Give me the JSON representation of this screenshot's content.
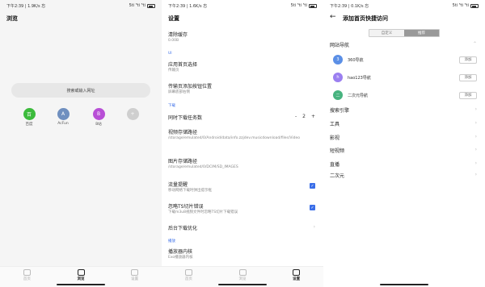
{
  "panel1": {
    "status": {
      "time": "下午2:39 | 1.9K/s 忘",
      "icons": "5ti ⁵ti ⁵ti"
    },
    "title": "浏览",
    "search_placeholder": "搜索或输入网址",
    "shortcuts": [
      {
        "glyph": "百",
        "label": "百度",
        "color": "#3cbb3c"
      },
      {
        "glyph": "A",
        "label": "AcFun",
        "color": "#6f8fbf"
      },
      {
        "glyph": "B",
        "label": "B站",
        "color": "#b84fd6"
      },
      {
        "glyph": "+",
        "label": "",
        "color": "#cfcfcf"
      }
    ],
    "nav": [
      {
        "label": "首页",
        "active": false
      },
      {
        "label": "浏览",
        "active": true
      },
      {
        "label": "设置",
        "active": false
      }
    ]
  },
  "panel2": {
    "status": {
      "time": "下午2:39 | 1.6K/s 忘",
      "icons": "5ti ⁵ti ⁵ti"
    },
    "title": "设置",
    "clear_cache": {
      "title": "清除缓存",
      "sub": "0.00B"
    },
    "ui_header": "UI",
    "app_home": {
      "title": "应用首页选择",
      "sub": "传输页"
    },
    "transfer_btn": {
      "title": "传输页添加按钮位置",
      "sub": "屏幕底部右侧"
    },
    "download_header": "下载",
    "concurrent": {
      "title": "同时下载任务数",
      "minus": "-",
      "value": "2",
      "plus": "+"
    },
    "video_path": {
      "title": "视频存储路径",
      "sub": "/storage/emulated/0/Android/data/info.zzjdev.musicdownload/files/Video"
    },
    "image_path": {
      "title": "图片存储路径",
      "sub": "/storage/emulated/0/DCIM/SD_IMAGES"
    },
    "traffic": {
      "title": "流量提醒",
      "sub": "移动网络下载时弹出提示框",
      "checked": true
    },
    "ignore_ts": {
      "title": "忽略TS切片错误",
      "sub": "下载m3u8视频文件时忽略TS切片下载错误",
      "checked": true
    },
    "bg_opt": {
      "title": "后台下载优化"
    },
    "play_header": "播放",
    "player": {
      "title": "播放器内核",
      "sub": "Exo播放器内核"
    },
    "nav": [
      {
        "label": "首页",
        "active": false
      },
      {
        "label": "浏览",
        "active": false
      },
      {
        "label": "设置",
        "active": true
      }
    ]
  },
  "panel3": {
    "status": {
      "time": "下午2:39 | 0.1K/s 忘",
      "icons": "5ti ⁵ti ⁵ti"
    },
    "back": "←",
    "title": "添加首页快捷访问",
    "tabs": [
      {
        "label": "自定义",
        "active": false
      },
      {
        "label": "推荐",
        "active": true
      }
    ],
    "section_open": "网站导航",
    "sites": [
      {
        "glyph": "3",
        "name": "360导航",
        "color": "#5b8fe6",
        "btn": "添加"
      },
      {
        "glyph": "h",
        "name": "hao123导航",
        "color": "#9b7ff0",
        "btn": "添加"
      },
      {
        "glyph": "二",
        "name": "二次元导航",
        "color": "#47b37f",
        "btn": "添加"
      }
    ],
    "categories": [
      "搜索引擎",
      "工具",
      "影视",
      "短视频",
      "直播",
      "二次元"
    ]
  }
}
